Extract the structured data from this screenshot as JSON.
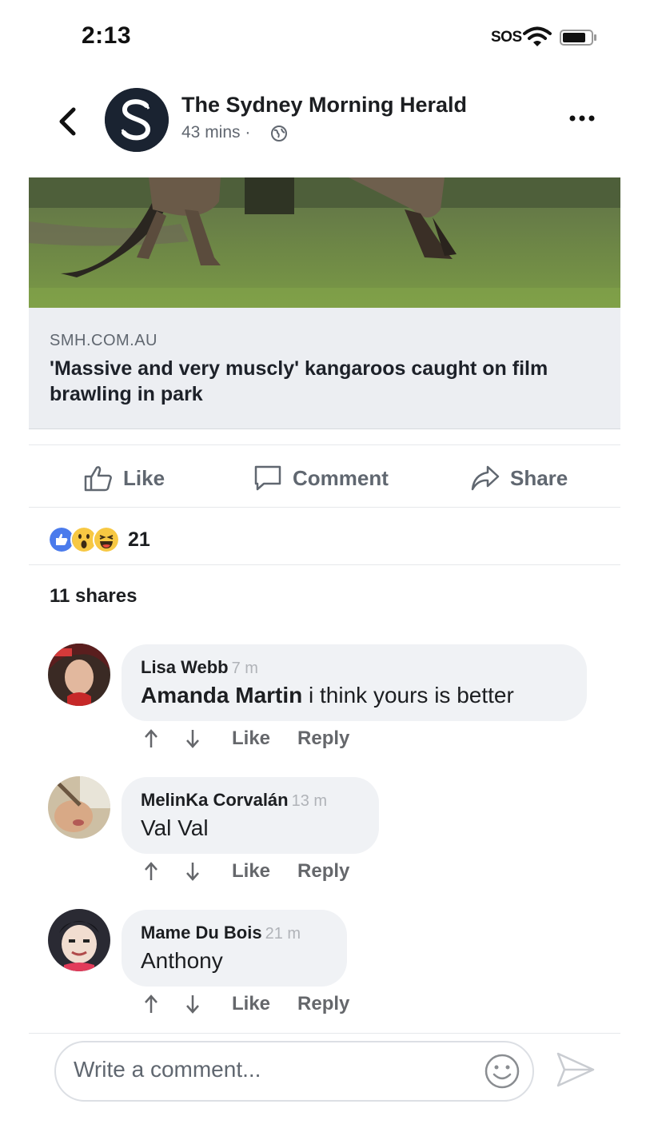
{
  "status_bar": {
    "time": "2:13",
    "sos": "SOS",
    "wifi_icon": "wifi-icon",
    "battery_icon": "battery-icon"
  },
  "post": {
    "page_name": "The Sydney Morning Herald",
    "timestamp": "43 mins · ",
    "privacy_icon": "globe-icon",
    "avatar_letter": "S",
    "link": {
      "source": "SMH.COM.AU",
      "headline": "'Massive and very muscly' kangaroos caught on film brawling in  park"
    }
  },
  "actions": {
    "like": "Like",
    "comment": "Comment",
    "share": "Share"
  },
  "reactions": {
    "types": [
      "like",
      "wow",
      "haha"
    ],
    "count": "21"
  },
  "shares": "11 shares",
  "comments": [
    {
      "author": "Lisa Webb",
      "time": "7 m",
      "mention": "Amanda Martin",
      "text": " i think yours is better",
      "like": "Like",
      "reply": "Reply"
    },
    {
      "author": "MelinKa Corvalán",
      "time": "13 m",
      "mention": "",
      "text": "Val Val",
      "like": "Like",
      "reply": "Reply"
    },
    {
      "author": "Mame Du Bois",
      "time": "21 m",
      "mention": "",
      "text": "Anthony",
      "like": "Like",
      "reply": "Reply"
    }
  ],
  "composer": {
    "placeholder": "Write a comment..."
  },
  "colors": {
    "like_blue": "#4b7bec",
    "reaction_yellow": "#f7c843",
    "muted_text": "#606770",
    "bubble": "#f0f2f5"
  }
}
